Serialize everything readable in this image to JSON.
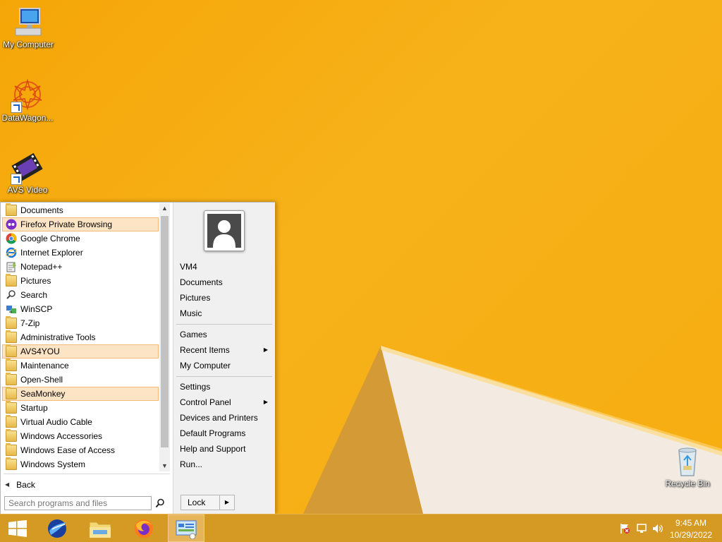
{
  "desktop": {
    "icons": [
      {
        "label": "My Computer"
      },
      {
        "label": "DataWagon..."
      },
      {
        "label": "AVS Video"
      },
      {
        "label": "Recycle Bin"
      }
    ]
  },
  "start_menu": {
    "programs": [
      {
        "label": "Documents"
      },
      {
        "label": "Firefox Private Browsing"
      },
      {
        "label": "Google Chrome"
      },
      {
        "label": "Internet Explorer"
      },
      {
        "label": "Notepad++"
      },
      {
        "label": "Pictures"
      },
      {
        "label": "Search"
      },
      {
        "label": "WinSCP"
      },
      {
        "label": "7-Zip"
      },
      {
        "label": "Administrative Tools"
      },
      {
        "label": "AVS4YOU"
      },
      {
        "label": "Maintenance"
      },
      {
        "label": "Open-Shell"
      },
      {
        "label": "SeaMonkey"
      },
      {
        "label": "Startup"
      },
      {
        "label": "Virtual Audio Cable"
      },
      {
        "label": "Windows Accessories"
      },
      {
        "label": "Windows Ease of Access"
      },
      {
        "label": "Windows System"
      }
    ],
    "back_label": "Back",
    "search_placeholder": "Search programs and files",
    "right_items": [
      {
        "label": "VM4"
      },
      {
        "label": "Documents"
      },
      {
        "label": "Pictures"
      },
      {
        "label": "Music"
      },
      {
        "label": "Games"
      },
      {
        "label": "Recent Items"
      },
      {
        "label": "My Computer"
      },
      {
        "label": "Settings"
      },
      {
        "label": "Control Panel"
      },
      {
        "label": "Devices and Printers"
      },
      {
        "label": "Default Programs"
      },
      {
        "label": "Help and Support"
      },
      {
        "label": "Run..."
      }
    ],
    "lock_label": "Lock"
  },
  "taskbar": {
    "time": "9:45 AM",
    "date": "10/29/2022"
  },
  "colors": {
    "wallpaper": "#f6ab0e",
    "taskbar": "#d59a23",
    "highlight": "#fce4c5"
  }
}
